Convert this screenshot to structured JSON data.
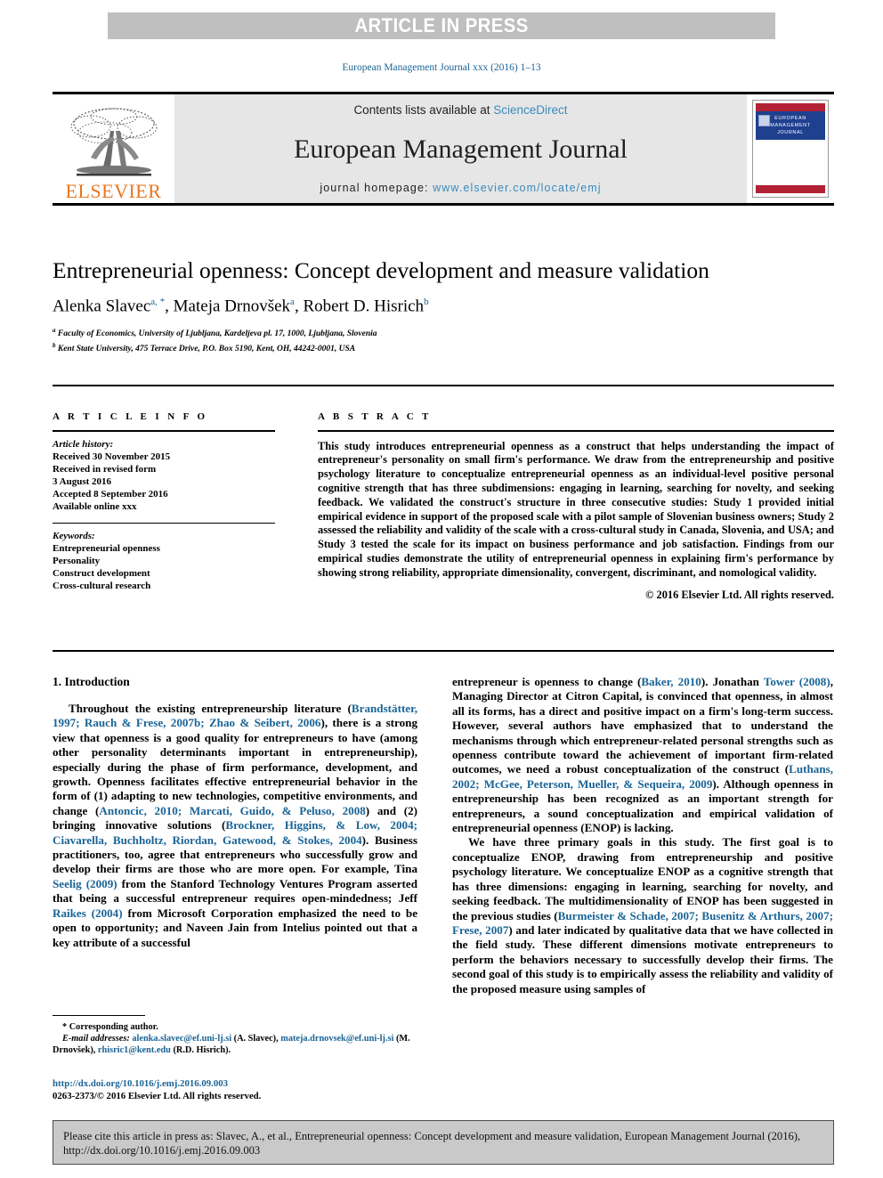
{
  "banner": {
    "label": "ARTICLE IN PRESS",
    "background_color": "#bfbfbf",
    "text_color": "#ffffff"
  },
  "running_head": "European Management Journal xxx (2016) 1–13",
  "masthead": {
    "publisher_logo_text": "ELSEVIER",
    "publisher_logo_color": "#e87722",
    "contents_prefix": "Contents lists available at ",
    "contents_link": "ScienceDirect",
    "journal_name": "European Management Journal",
    "homepage_prefix": "journal homepage: ",
    "homepage_url": "www.elsevier.com/locate/emj",
    "link_color": "#3b8bbd",
    "cover": {
      "line1": "EUROPEAN",
      "line2": "MANAGEMENT",
      "line3": "JOURNAL",
      "band_color": "#b22234",
      "panel_color": "#1f3f8f"
    }
  },
  "article": {
    "title": "Entrepreneurial openness: Concept development and measure validation",
    "authors": [
      {
        "name": "Alenka Slavec",
        "marks": "a, *"
      },
      {
        "name": "Mateja Drnovšek",
        "marks": "a"
      },
      {
        "name": "Robert D. Hisrich",
        "marks": "b"
      }
    ],
    "affiliations": [
      {
        "mark": "a",
        "text": "Faculty of Economics, University of Ljubljana, Kardeljeva pl. 17, 1000, Ljubljana, Slovenia"
      },
      {
        "mark": "b",
        "text": "Kent State University, 475 Terrace Drive, P.O. Box 5190, Kent, OH, 44242-0001, USA"
      }
    ]
  },
  "article_info": {
    "heading": "A R T I C L E   I N F O",
    "history_label": "Article history:",
    "history": [
      "Received 30 November 2015",
      "Received in revised form",
      "3 August 2016",
      "Accepted 8 September 2016",
      "Available online xxx"
    ],
    "keywords_label": "Keywords:",
    "keywords": [
      "Entrepreneurial openness",
      "Personality",
      "Construct development",
      "Cross-cultural research"
    ]
  },
  "abstract": {
    "heading": "A B S T R A C T",
    "text": "This study introduces entrepreneurial openness as a construct that helps understanding the impact of entrepreneur's personality on small firm's performance. We draw from the entrepreneurship and positive psychology literature to conceptualize entrepreneurial openness as an individual-level positive personal cognitive strength that has three subdimensions: engaging in learning, searching for novelty, and seeking feedback. We validated the construct's structure in three consecutive studies: Study 1 provided initial empirical evidence in support of the proposed scale with a pilot sample of Slovenian business owners; Study 2 assessed the reliability and validity of the scale with a cross-cultural study in Canada, Slovenia, and USA; and Study 3 tested the scale for its impact on business performance and job satisfaction. Findings from our empirical studies demonstrate the utility of entrepreneurial openness in explaining firm's performance by showing strong reliability, appropriate dimensionality, convergent, discriminant, and nomological validity.",
    "copyright": "© 2016 Elsevier Ltd. All rights reserved."
  },
  "body": {
    "section_number_title": "1. Introduction",
    "left_paragraphs": [
      {
        "runs": [
          {
            "t": "Throughout the existing entrepreneurship literature (",
            "k": "n"
          },
          {
            "t": "Brandstätter, 1997; Rauch & Frese, 2007b; Zhao & Seibert, 2006",
            "k": "r"
          },
          {
            "t": "), there is a strong view that openness is a good quality for entrepreneurs to have (among other personality determinants important in entrepreneurship), especially during the phase of firm performance, development, and growth. Openness facilitates effective entrepreneurial behavior in the form of (1) adapting to new technologies, competitive environments, and change (",
            "k": "n"
          },
          {
            "t": "Antoncic, 2010; Marcati, Guido, & Peluso, 2008",
            "k": "r"
          },
          {
            "t": ") and (2) bringing innovative solutions (",
            "k": "n"
          },
          {
            "t": "Brockner, Higgins, & Low, 2004; Ciavarella, Buchholtz, Riordan, Gatewood, & Stokes, 2004",
            "k": "r"
          },
          {
            "t": "). Business practitioners, too, agree that entrepreneurs who successfully grow and develop their firms are those who are more open. For example, Tina ",
            "k": "n"
          },
          {
            "t": "Seelig (2009)",
            "k": "r"
          },
          {
            "t": " from the Stanford Technology Ventures Program asserted that being a successful entrepreneur requires open-mindedness; Jeff ",
            "k": "n"
          },
          {
            "t": "Raikes (2004)",
            "k": "r"
          },
          {
            "t": " from Microsoft Corporation emphasized the need to be open to opportunity; and Naveen Jain from Intelius pointed out that a key attribute of a successful",
            "k": "n"
          }
        ]
      }
    ],
    "right_paragraphs": [
      {
        "runs": [
          {
            "t": "entrepreneur is openness to change (",
            "k": "n"
          },
          {
            "t": "Baker, 2010",
            "k": "r"
          },
          {
            "t": "). Jonathan ",
            "k": "n"
          },
          {
            "t": "Tower (2008)",
            "k": "r"
          },
          {
            "t": ", Managing Director at Citron Capital, is convinced that openness, in almost all its forms, has a direct and positive impact on a firm's long-term success. However, several authors have emphasized that to understand the mechanisms through which entrepreneur-related personal strengths such as openness contribute toward the achievement of important firm-related outcomes, we need a robust conceptualization of the construct (",
            "k": "n"
          },
          {
            "t": "Luthans, 2002; McGee, Peterson, Mueller, & Sequeira, 2009",
            "k": "r"
          },
          {
            "t": "). Although openness in entrepreneurship has been recognized as an important strength for entrepreneurs, a sound conceptualization and empirical validation of entrepreneurial openness (ENOP) is lacking.",
            "k": "n"
          }
        ],
        "indent": false
      },
      {
        "runs": [
          {
            "t": "We have three primary goals in this study. The first goal is to conceptualize ENOP, drawing from entrepreneurship and positive psychology literature. We conceptualize ENOP as a cognitive strength that has three dimensions: engaging in learning, searching for novelty, and seeking feedback. The multidimensionality of ENOP has been suggested in the previous studies (",
            "k": "n"
          },
          {
            "t": "Burmeister & Schade, 2007; Busenitz & Arthurs, 2007; Frese, 2007",
            "k": "r"
          },
          {
            "t": ") and later indicated by qualitative data that we have collected in the field study. These different dimensions motivate entrepreneurs to perform the behaviors necessary to successfully develop their firms. The second goal of this study is to empirically assess the reliability and validity of the proposed measure using samples of",
            "k": "n"
          }
        ],
        "indent": true
      }
    ]
  },
  "footnotes": {
    "corresponding_marker": "*",
    "corresponding_text": "Corresponding author.",
    "email_label": "E-mail addresses:",
    "emails": [
      {
        "address": "alenka.slavec@ef.uni-lj.si",
        "owner": "(A. Slavec)"
      },
      {
        "address": "mateja.drnovsek@ef.uni-lj.si",
        "owner": "(M. Drnovšek)"
      },
      {
        "address": "rhisric1@kent.edu",
        "owner": "(R.D. Hisrich)"
      }
    ]
  },
  "doi_block": {
    "doi_url": "http://dx.doi.org/10.1016/j.emj.2016.09.003",
    "issn_line": "0263-2373/© 2016 Elsevier Ltd. All rights reserved."
  },
  "cite_box": {
    "text": "Please cite this article in press as: Slavec, A., et al., Entrepreneurial openness: Concept development and measure validation, European Management Journal (2016), http://dx.doi.org/10.1016/j.emj.2016.09.003",
    "background_color": "#c9c9c9"
  }
}
